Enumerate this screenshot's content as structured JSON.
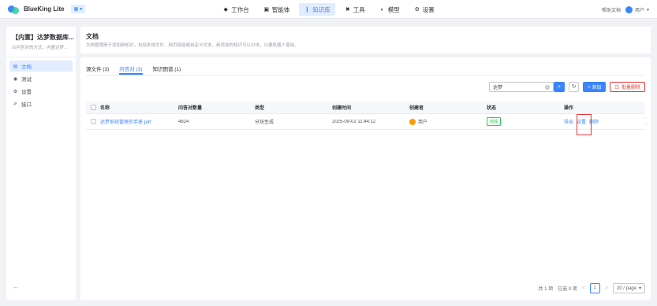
{
  "nav": {
    "brand": "BlueKing Lite",
    "env_chip": "▾",
    "items": [
      {
        "icon": "◆",
        "label": "工作台"
      },
      {
        "icon": "▣",
        "label": "智能体"
      },
      {
        "icon": "❙",
        "label": "知识库"
      },
      {
        "icon": "✖",
        "label": "工具"
      },
      {
        "icon": "◐",
        "label": "模型"
      },
      {
        "icon": "⚙",
        "label": "设置"
      }
    ],
    "doc_link": "帮助文档",
    "user": "用户"
  },
  "sidebar": {
    "kb_title": "【内置】达梦数据库...",
    "kb_desc": "以问答对的方式，内置达梦...",
    "items": [
      {
        "icon": "▤",
        "label": "文档"
      },
      {
        "icon": "◉",
        "label": "测试"
      },
      {
        "icon": "⚙",
        "label": "设置"
      },
      {
        "icon": "✐",
        "label": "接口"
      }
    ],
    "collapse": "←"
  },
  "header": {
    "title": "文档",
    "desc": "文档管理用于添加新知识，包括本地文件、网页链接或自定义文本。新添加的知识可以分块，以便机器人使用。"
  },
  "tabs": [
    "源文件 (3)",
    "问答对 (3)",
    "知识图谱 (1)"
  ],
  "toolbar": {
    "search_value": "达梦",
    "search_icon": "⌕",
    "refresh_icon": "↻",
    "add_label": "+ 添加",
    "delete_label": "批量删除"
  },
  "table": {
    "headers": [
      "名称",
      "问答对数量",
      "类型",
      "创建时间",
      "创建者",
      "状态",
      "操作"
    ],
    "row": {
      "name": "达梦系统管理员手册.pdf",
      "count": "4824",
      "type": "分块生成",
      "created_at": "2025-09-02 11:44:12",
      "creator": "用户",
      "status": "完成",
      "ops": [
        "导出",
        "设置",
        "删除"
      ]
    }
  },
  "pager": {
    "total": "共 1 项",
    "selected": "已选 0 项",
    "prev": "<",
    "page": "1",
    "next": ">",
    "page_size": "20 / page"
  },
  "colors": {
    "accent": "#3a84ff",
    "danger": "#ea3636",
    "success": "#2dcb56"
  }
}
